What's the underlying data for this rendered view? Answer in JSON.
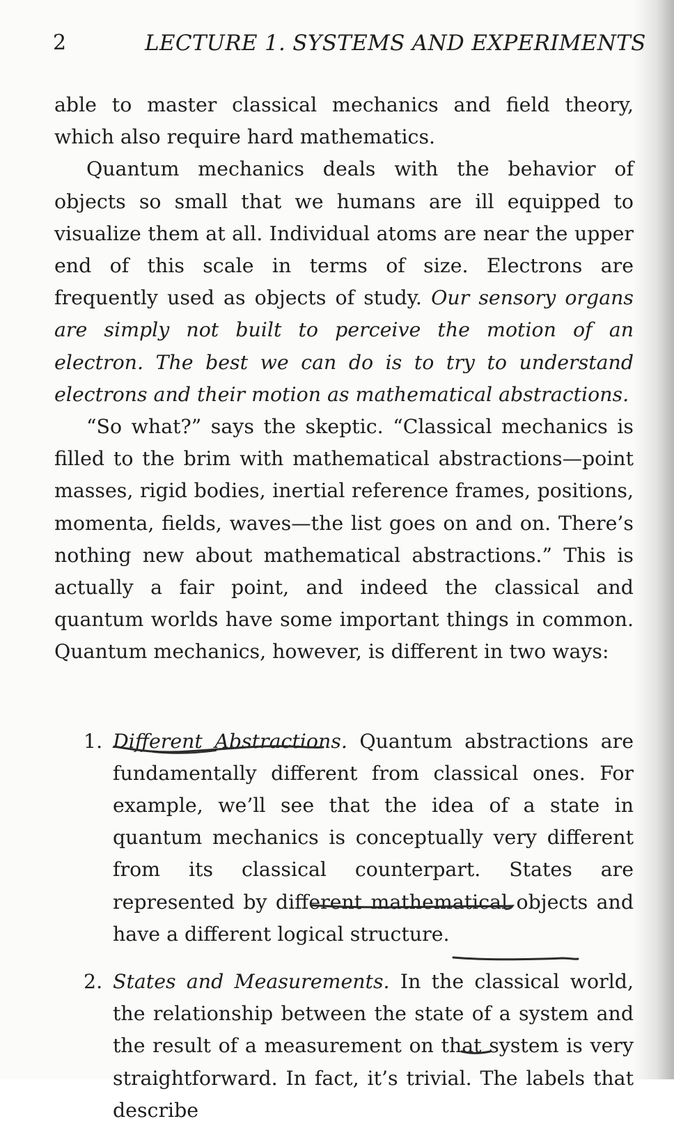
{
  "running_head": {
    "page_number": "2",
    "chapter_title": "LECTURE 1.  SYSTEMS AND EXPERIMENTS"
  },
  "paragraph_1": "able to master classical mechanics and field theory, which also require hard mathematics.",
  "paragraph_2": {
    "lead": "Quantum mechanics deals with the behavior of objects so small that we humans are ill equipped to visualize them at all. Individual atoms are near the upper end of this scale in terms of size. Electrons are frequently used as objects of study. ",
    "emphasis": "Our sensory organs are simply not built to perceive the motion of an electron.  The best we can do is to try to understand electrons and their motion as mathematical abstractions."
  },
  "paragraph_3": "“So what?” says the skeptic. “Classical mechanics is filled to the brim with mathematical abstractions—point masses, rigid bodies, inertial reference frames, positions, momenta, fields, waves—the list goes on and on. There’s nothing new about mathematical abstractions.” This is actually a fair point, and indeed the classical and quantum worlds have some important things in common. Quantum mechanics, however, is different in two ways:",
  "list": [
    {
      "number": "1.",
      "heading": "Different Abstractions.",
      "text": " Quantum abstractions are fundamentally different from classical ones. For example, we’ll see that the idea of a state in quantum mechanics is conceptually very different from its classical counterpart. States are represented by different mathematical objects and have a different logical structure."
    },
    {
      "number": "2.",
      "heading": "States and Measurements.",
      "text": " In the classical world, the relationship between the state of a system and the result of a measurement on that system is very straightforward. In fact, it’s trivial. The labels that describe"
    }
  ],
  "annotation_color": "#2a2a2a"
}
